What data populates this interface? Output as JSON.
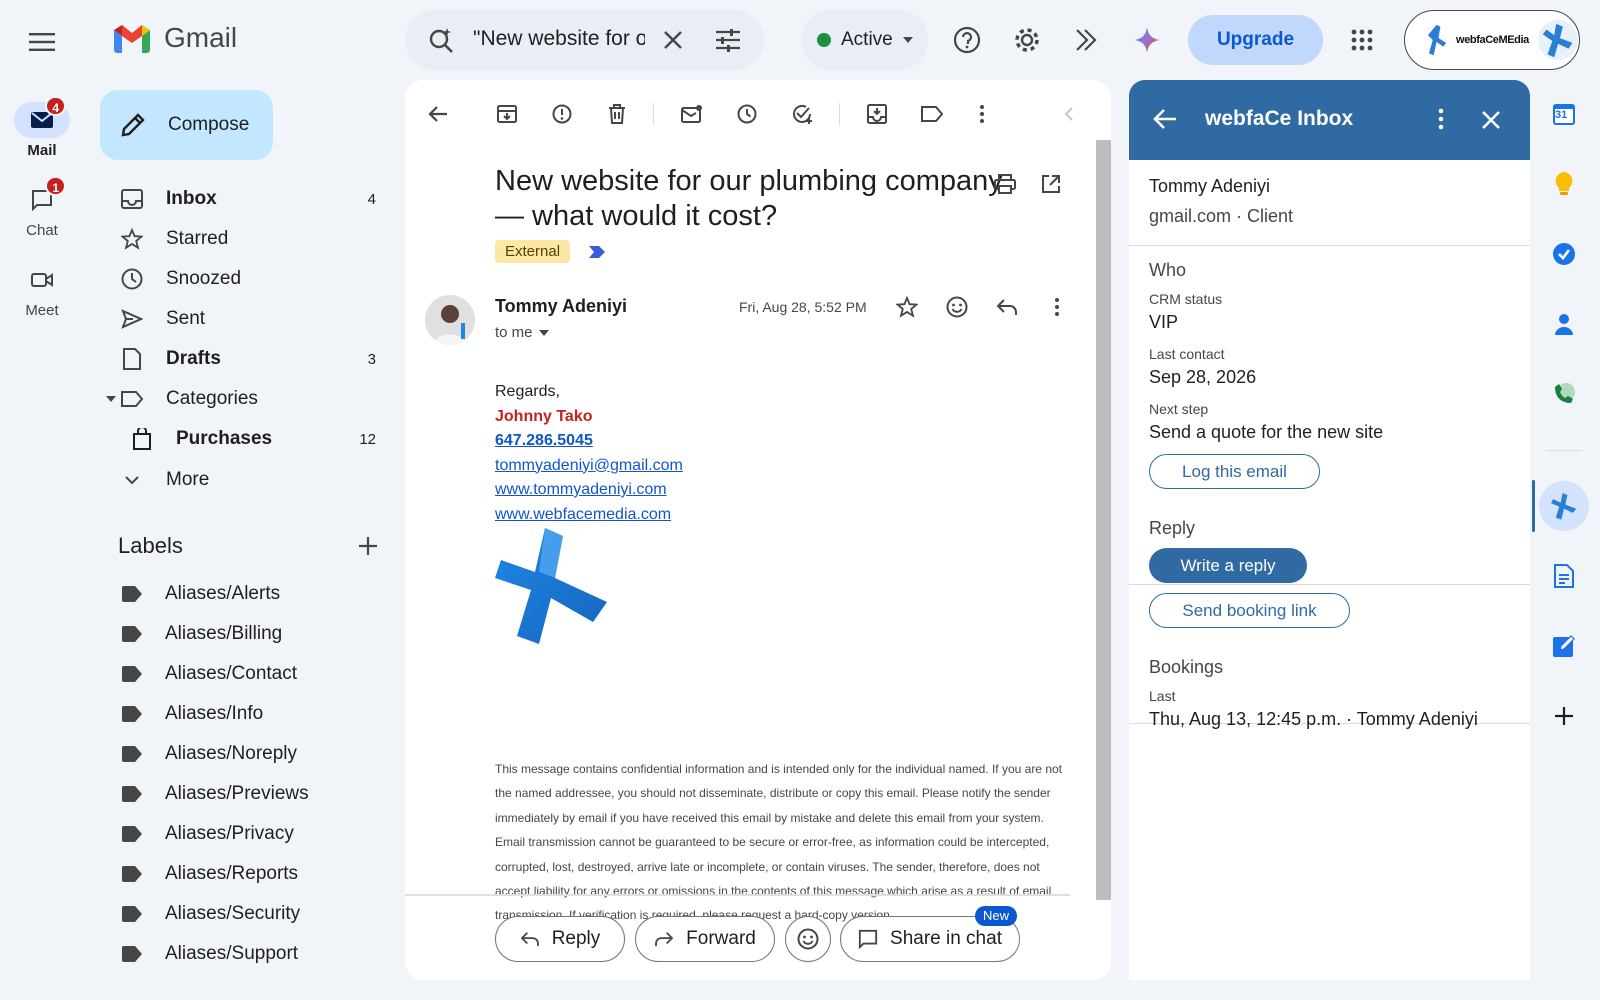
{
  "rail": {
    "items": [
      {
        "label": "Mail",
        "badge": "4",
        "icon": "mail-icon"
      },
      {
        "label": "Chat",
        "badge": "1",
        "icon": "chat-icon"
      },
      {
        "label": "Meet",
        "icon": "video-icon"
      }
    ]
  },
  "header": {
    "logo_text": "Gmail",
    "search_value": "\"New website for o",
    "status": "Active",
    "upgrade_label": "Upgrade",
    "account_brand": "webfaCeMEdia"
  },
  "nav": {
    "compose_label": "Compose",
    "items": [
      {
        "label": "Inbox",
        "count": "4",
        "icon": "inbox-icon"
      },
      {
        "label": "Starred",
        "count": "",
        "icon": "star-icon"
      },
      {
        "label": "Snoozed",
        "count": "",
        "icon": "clock-icon"
      },
      {
        "label": "Sent",
        "count": "",
        "icon": "send-icon"
      },
      {
        "label": "Drafts",
        "count": "3",
        "icon": "draft-icon"
      },
      {
        "label": "Categories",
        "count": "",
        "icon": "label-icon"
      },
      {
        "label": "Purchases",
        "count": "12",
        "icon": "shopping-bag-icon"
      },
      {
        "label": "More",
        "count": "",
        "icon": "chevron-down-icon"
      }
    ],
    "labels_heading": "Labels",
    "labels": [
      "Aliases/Alerts",
      "Aliases/Billing",
      "Aliases/Contact",
      "Aliases/Info",
      "Aliases/Noreply",
      "Aliases/Previews",
      "Aliases/Privacy",
      "Aliases/Reports",
      "Aliases/Security",
      "Aliases/Support"
    ]
  },
  "email": {
    "subject": "New website for our plumbing company — what would it cost?",
    "external_label": "External",
    "sender_name": "Tommy Adeniyi",
    "to_label": "to me",
    "date": "Fri, Aug 28, 5:52 PM",
    "signature": {
      "regards": "Regards,",
      "name": "Johnny Tako",
      "phone": "647.286.5045",
      "email": "tommyadeniyi@gmail.com",
      "site1": "www.tommyadeniyi.com",
      "site2": "www.webfacemedia.com"
    },
    "disclaimer": "This message contains confidential information and is intended only for the individual named. If you are not the named addressee, you should not disseminate, distribute or copy this email. Please notify the sender immediately by email if you have received this email by mistake and delete this email from your system. Email transmission cannot be guaranteed to be secure or error-free, as information could be intercepted, corrupted, lost, destroyed, arrive late or incomplete, or contain viruses. The sender, therefore, does not accept liability for any errors or omissions in the contents of this message which arise as a result of email transmission. If verification is required, please request a hard-copy version.",
    "reply_label": "Reply",
    "forward_label": "Forward",
    "share_label": "Share in chat",
    "new_badge": "New"
  },
  "side_panel": {
    "title": "webfaCe Inbox",
    "contact_name": "Tommy Adeniyi",
    "contact_meta": "gmail.com · Client",
    "who_heading": "Who",
    "crm_label": "CRM status",
    "crm_value": "VIP",
    "last_contact_label": "Last contact",
    "last_contact_value": "Sep 28, 2026",
    "next_step_label": "Next step",
    "next_step_value": "Send a quote for the new site",
    "log_button": "Log this email",
    "reply_heading": "Reply",
    "write_reply_button": "Write a reply",
    "booking_button": "Send booking link",
    "bookings_heading": "Bookings",
    "last_label": "Last",
    "last_booking": "Thu, Aug 13, 12:45 p.m. · Tommy Adeniyi"
  },
  "addons": {
    "calendar_day": "31"
  },
  "colors": {
    "compose_bg": "#c2e7ff",
    "panel_header": "#2f6aa3",
    "badge_red": "#c5221f",
    "external_chip": "#fce8a6",
    "status_green": "#1e8e3e"
  }
}
